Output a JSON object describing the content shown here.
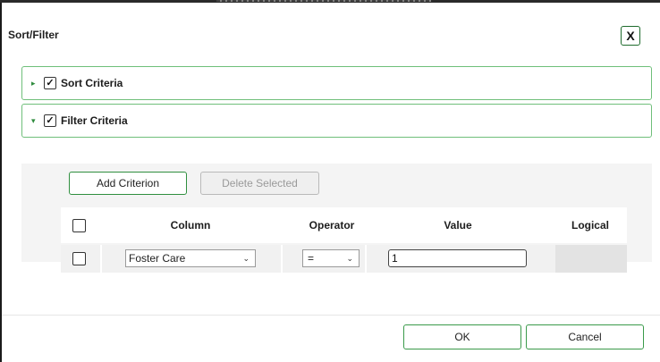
{
  "dialog": {
    "title": "Sort/Filter",
    "close_label": "X"
  },
  "sections": {
    "sort": {
      "label": "Sort Criteria",
      "checked": true,
      "expanded": false
    },
    "filter": {
      "label": "Filter Criteria",
      "checked": true,
      "expanded": true
    }
  },
  "toolbar": {
    "add_label": "Add Criterion",
    "delete_label": "Delete Selected"
  },
  "grid": {
    "headers": {
      "column": "Column",
      "operator": "Operator",
      "value": "Value",
      "logical": "Logical"
    },
    "rows": [
      {
        "column": "Foster Care",
        "operator": "=",
        "value": "1",
        "logical": ""
      }
    ]
  },
  "footer": {
    "ok_label": "OK",
    "cancel_label": "Cancel"
  },
  "icons": {
    "caret_collapsed": "caret-right-icon",
    "caret_expanded": "caret-down-icon",
    "dropdown": "chevron-down-icon"
  },
  "colors": {
    "accent": "#2f8f3f",
    "section_border": "#6fbf7a",
    "filter_bg": "#f4f4f4",
    "disabled_text": "#9a9a9a"
  }
}
